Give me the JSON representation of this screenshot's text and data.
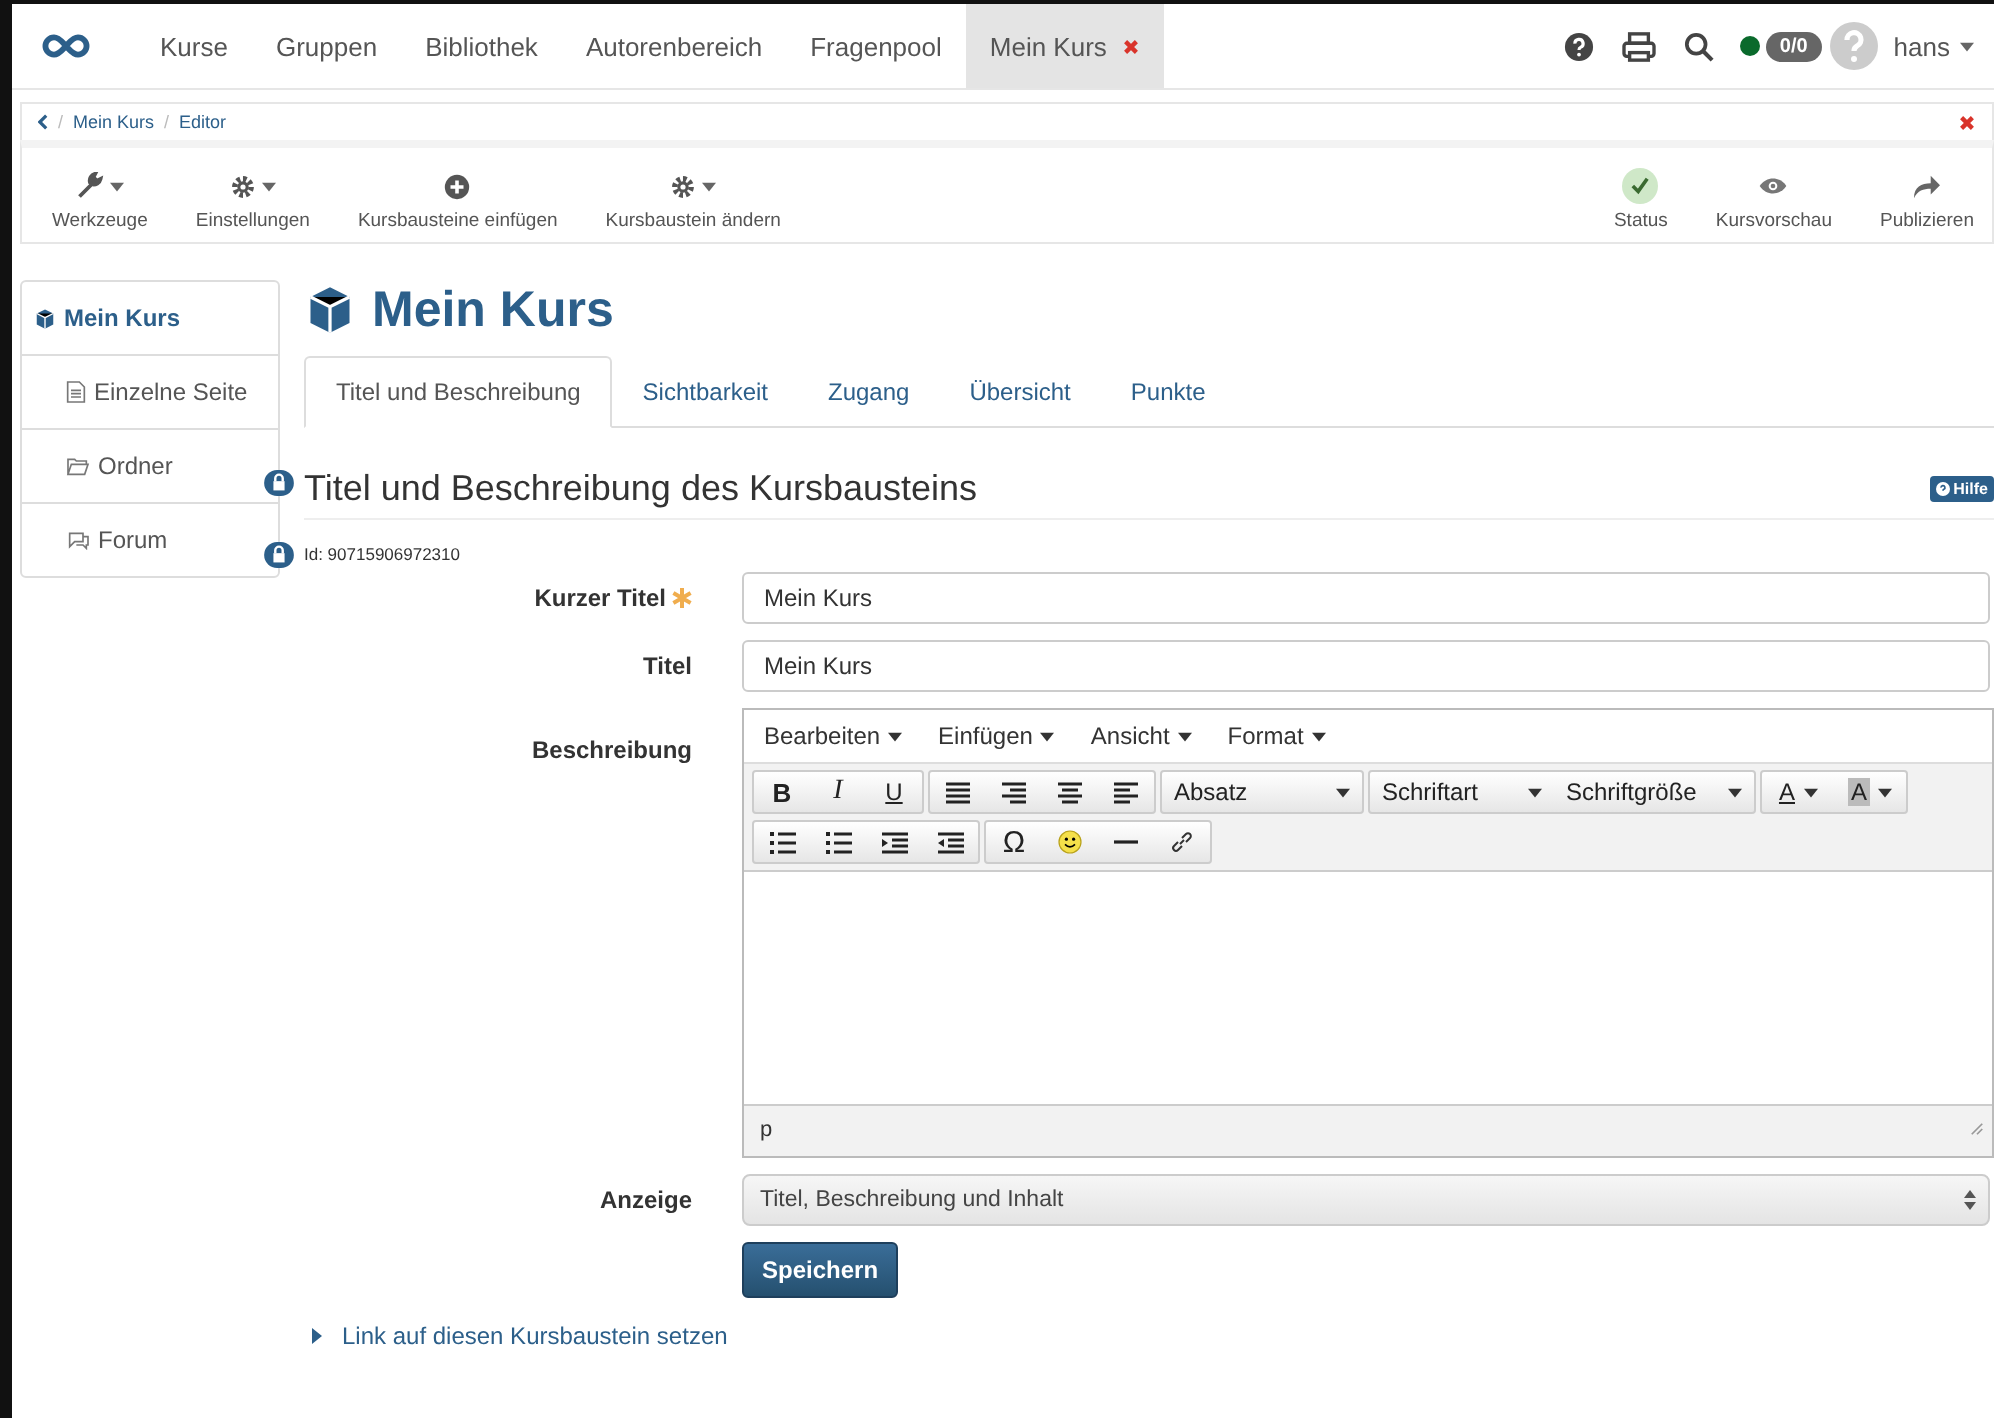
{
  "nav": {
    "tabs": [
      {
        "label": "Kurse",
        "selected": false,
        "closable": false
      },
      {
        "label": "Gruppen",
        "selected": false,
        "closable": false
      },
      {
        "label": "Bibliothek",
        "selected": false,
        "closable": false
      },
      {
        "label": "Autorenbereich",
        "selected": false,
        "closable": false
      },
      {
        "label": "Fragenpool",
        "selected": false,
        "closable": false
      },
      {
        "label": "Mein Kurs",
        "selected": true,
        "closable": true
      }
    ],
    "online": true,
    "badge": "0/0",
    "user": "hans"
  },
  "breadcrumb": {
    "separator": "/",
    "items": [
      "Mein Kurs",
      "Editor"
    ]
  },
  "toolbar": {
    "left": [
      {
        "label": "Werkzeuge",
        "dropdown": true
      },
      {
        "label": "Einstellungen",
        "dropdown": true
      },
      {
        "label": "Kursbausteine einfügen",
        "dropdown": false
      },
      {
        "label": "Kursbaustein ändern",
        "dropdown": true
      }
    ],
    "right": [
      {
        "label": "Status"
      },
      {
        "label": "Kursvorschau"
      },
      {
        "label": "Publizieren"
      }
    ]
  },
  "sidebar": {
    "items": [
      {
        "label": "Mein Kurs",
        "selected": true,
        "children": [
          {
            "label": "Einzelne Seite",
            "selected": false,
            "locked": false
          },
          {
            "label": "Ordner",
            "selected": false,
            "locked": true
          },
          {
            "label": "Forum",
            "selected": false,
            "locked": true
          }
        ]
      }
    ]
  },
  "title": "Mein Kurs",
  "tabs": [
    {
      "label": "Titel und Beschreibung",
      "selected": true
    },
    {
      "label": "Sichtbarkeit",
      "selected": false
    },
    {
      "label": "Zugang",
      "selected": false
    },
    {
      "label": "Übersicht",
      "selected": false
    },
    {
      "label": "Punkte",
      "selected": false
    }
  ],
  "section": {
    "heading": "Titel und Beschreibung des Kursbausteins",
    "help": "Hilfe",
    "id": "Id: 90715906972310"
  },
  "form": {
    "short_title": {
      "label": "Kurzer Titel",
      "required": true,
      "value": "Mein Kurs"
    },
    "title": {
      "label": "Titel",
      "value": "Mein Kurs"
    },
    "description": {
      "label": "Beschreibung",
      "menus": [
        "Bearbeiten",
        "Einfügen",
        "Ansicht",
        "Format"
      ],
      "text_buttons": [
        "B",
        "I",
        "U"
      ],
      "selects": [
        "Absatz",
        "Schriftart",
        "Schriftgröße"
      ],
      "color_buttons": [
        {
          "label": "A",
          "kind": "text"
        },
        {
          "label": "A",
          "kind": "background"
        }
      ],
      "omega": "Ω",
      "path": "p"
    },
    "display": {
      "label": "Anzeige",
      "value": "Titel, Beschreibung und Inhalt"
    },
    "save": "Speichern"
  },
  "link": "Link auf diesen Kursbaustein setzen"
}
